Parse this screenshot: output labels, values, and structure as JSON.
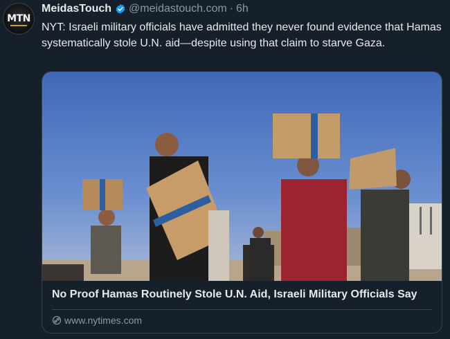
{
  "account": {
    "display_name": "MeidasTouch",
    "handle": "@meidastouch.com",
    "separator": "·",
    "time": "6h",
    "avatar_text": "MTN",
    "verified_icon": "verified-badge-icon"
  },
  "post": {
    "text": "NYT: Israeli military officials have admitted they never found evidence that Hamas systematically stole U.N. aid—despite using that claim to starve Gaza."
  },
  "link_card": {
    "title": "No Proof Hamas Routinely Stole U.N. Aid, Israeli Military Officials Say",
    "domain": "www.nytimes.com",
    "domain_icon": "link-icon"
  },
  "colors": {
    "background": "#15202b",
    "primary_text": "#e7e9ea",
    "secondary_text": "#8b98a5",
    "border": "#38444d",
    "verified_blue": "#1d9bf0"
  }
}
